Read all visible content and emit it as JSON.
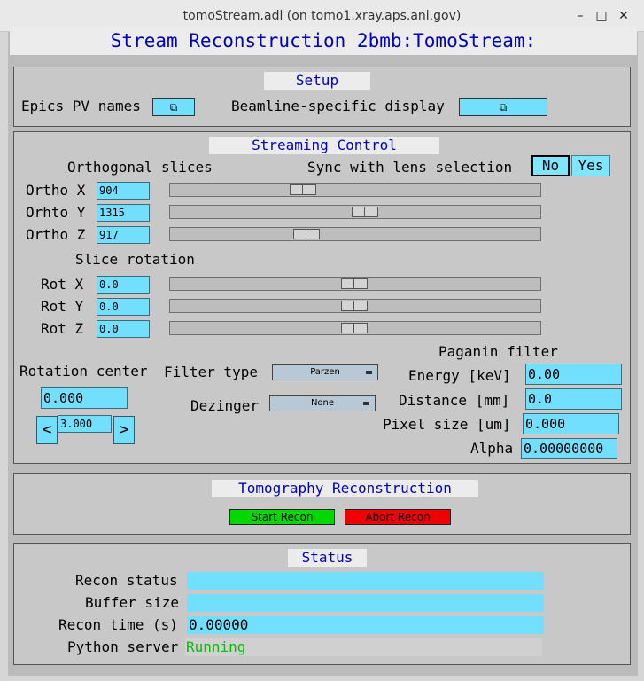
{
  "window": {
    "title": "tomoStream.adl (on tomo1.xray.aps.anl.gov)",
    "minimize_icon": "minimize-icon",
    "maximize_icon": "maximize-icon",
    "close_icon": "close-icon"
  },
  "heading": "Stream Reconstruction 2bmb:TomoStream:",
  "setup": {
    "title": "Setup",
    "epics_label": "Epics PV names",
    "beamline_label": "Beamline-specific display"
  },
  "streaming": {
    "title": "Streaming Control",
    "orthogonal_label": "Orthogonal slices",
    "sync_label": "Sync with lens selection",
    "sync_no": "No",
    "sync_yes": "Yes",
    "ortho": [
      {
        "label": "Ortho X",
        "value": "904",
        "position": 0.35
      },
      {
        "label": "Orhto Y",
        "value": "1315",
        "position": 0.53
      },
      {
        "label": "Ortho Z",
        "value": "917",
        "position": 0.36
      }
    ],
    "rotation_label": "Slice rotation",
    "rot": [
      {
        "label": "Rot X",
        "value": "0.0",
        "position": 0.5
      },
      {
        "label": "Rot Y",
        "value": "0.0",
        "position": 0.5
      },
      {
        "label": "Rot Z",
        "value": "0.0",
        "position": 0.5
      }
    ],
    "rotation_center_label": "Rotation center",
    "rotation_center_value": "0.000",
    "tweak_left": "<",
    "tweak_right": ">",
    "tweak_value": "3.000",
    "filter_type_label": "Filter type",
    "filter_type_value": "Parzen",
    "dezinger_label": "Dezinger",
    "dezinger_value": "None",
    "paganin_label": "Paganin filter",
    "energy_label": "Energy [keV]",
    "energy_value": "0.00",
    "distance_label": "Distance [mm]",
    "distance_value": "0.0",
    "pixel_label": "Pixel size [um]",
    "pixel_value": "0.000",
    "alpha_label": "Alpha",
    "alpha_value": "0.00000000"
  },
  "tomography": {
    "title": "Tomography Reconstruction",
    "start_label": "Start Recon",
    "abort_label": "Abort Recon",
    "start_color": "#00d800",
    "abort_color": "#f00000"
  },
  "status": {
    "title": "Status",
    "recon_status_label": "Recon status",
    "recon_status_value": "",
    "buffer_label": "Buffer size",
    "buffer_value": "",
    "recon_time_label": "Recon time (s)",
    "recon_time_value": "0.00000",
    "python_label": "Python server",
    "python_value": "Running",
    "python_color": "#00c000"
  }
}
